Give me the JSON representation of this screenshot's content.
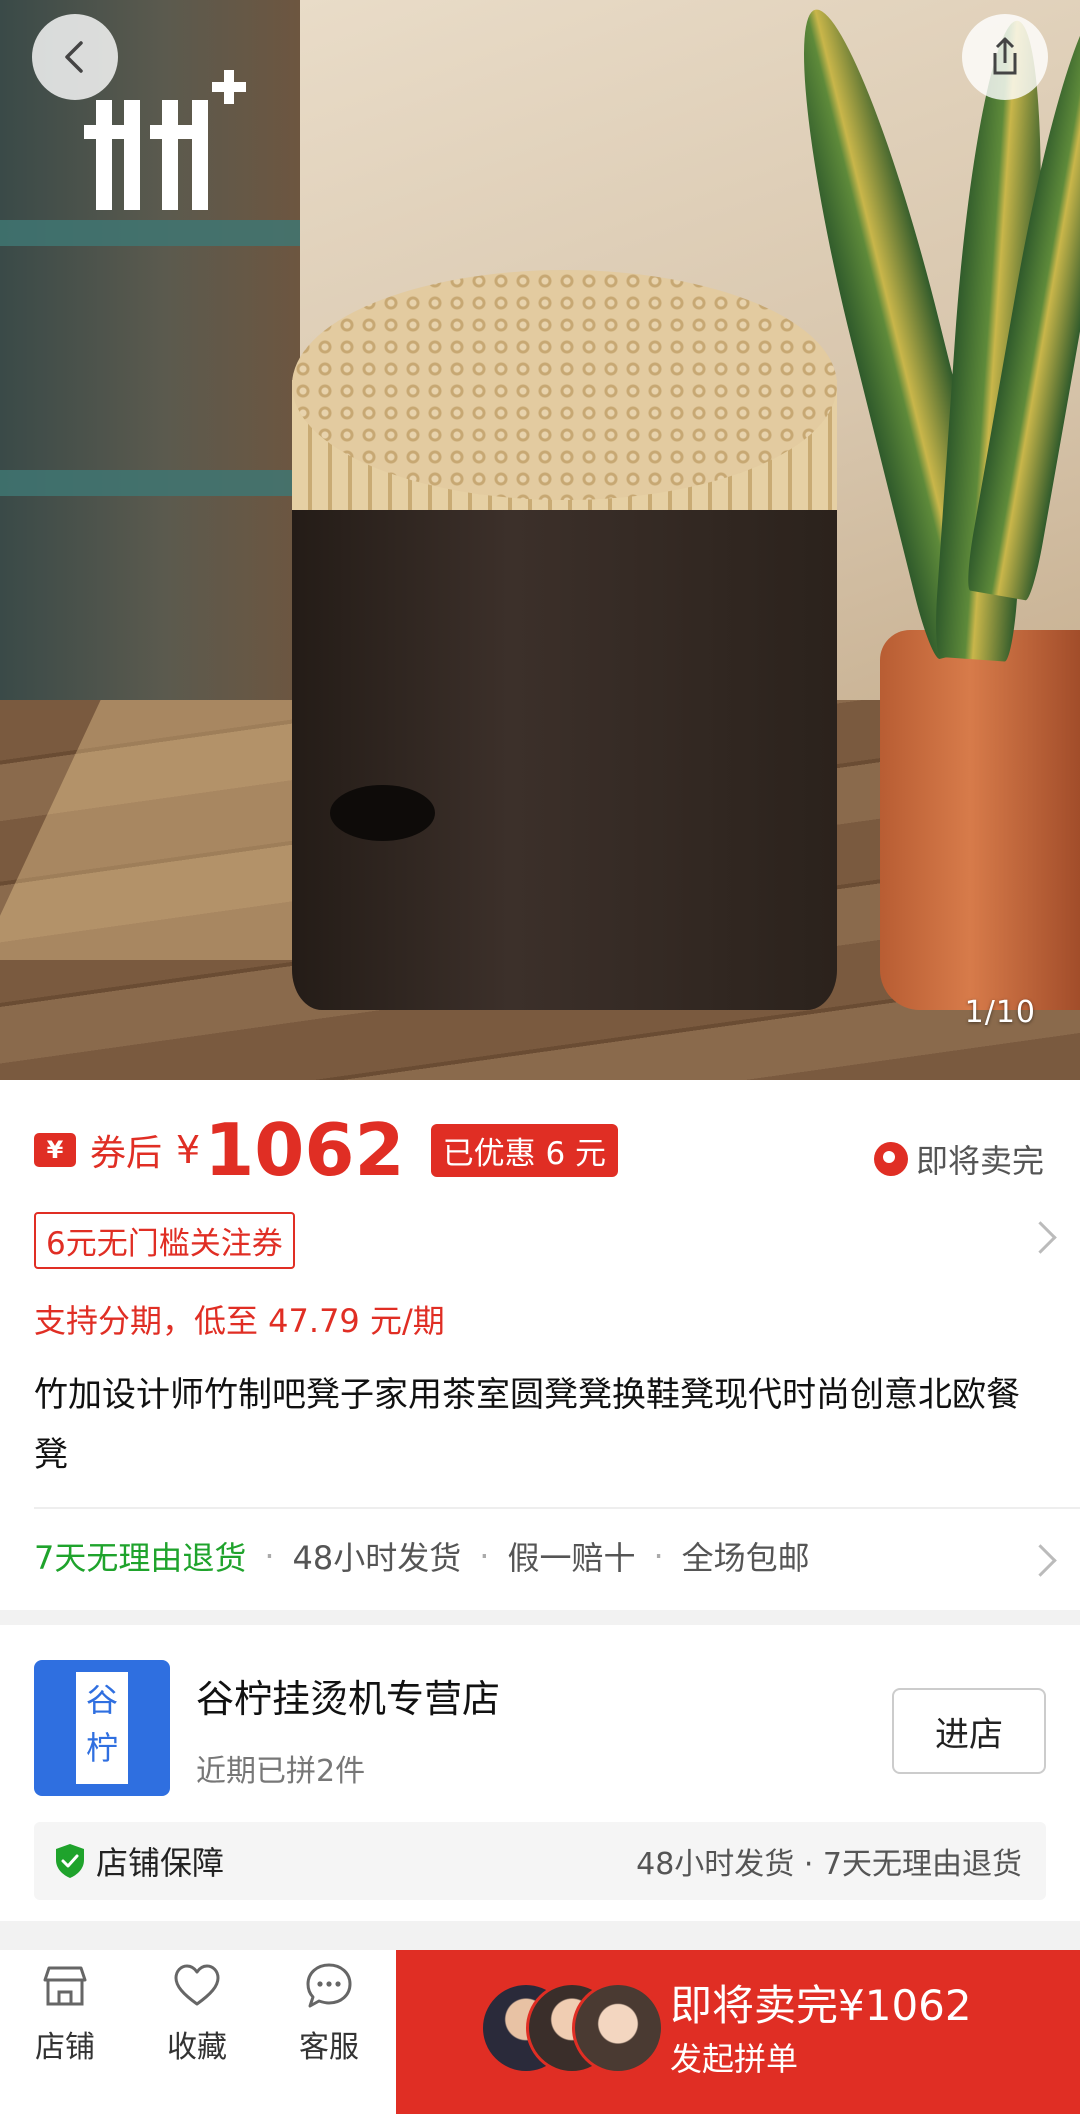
{
  "gallery": {
    "counter": "1/10"
  },
  "price": {
    "badge": "¥",
    "after_coupon_label": "券后",
    "currency": "¥",
    "amount": "1062",
    "discount_tag": "已优惠 6 元",
    "sellout_label": "即将卖完"
  },
  "coupon": {
    "label": "6元无门槛关注券"
  },
  "installment": {
    "text": "支持分期，低至 47.79 元/期"
  },
  "product": {
    "title": "竹加设计师竹制吧凳子家用茶室圆凳凳换鞋凳现代时尚创意北欧餐凳"
  },
  "services": [
    "7天无理由退货",
    "48小时发货",
    "假一赔十",
    "全场包邮"
  ],
  "shop": {
    "logo_text_1": "谷",
    "logo_text_2": "柠",
    "name": "谷柠挂烫机专营店",
    "sub": "近期已拼2件",
    "enter_label": "进店",
    "guarantee_label": "店铺保障",
    "guarantee_text": "48小时发货 · 7天无理由退货"
  },
  "bottom_bar": {
    "tabs": [
      {
        "label": "店铺",
        "icon": "store-icon"
      },
      {
        "label": "收藏",
        "icon": "heart-icon"
      },
      {
        "label": "客服",
        "icon": "chat-icon"
      }
    ],
    "buy_main": "即将卖完¥1062",
    "buy_sub": "发起拼单"
  },
  "colors": {
    "accent": "#e02e24",
    "green": "#1fa32c",
    "shop_blue": "#2f6fe0"
  }
}
